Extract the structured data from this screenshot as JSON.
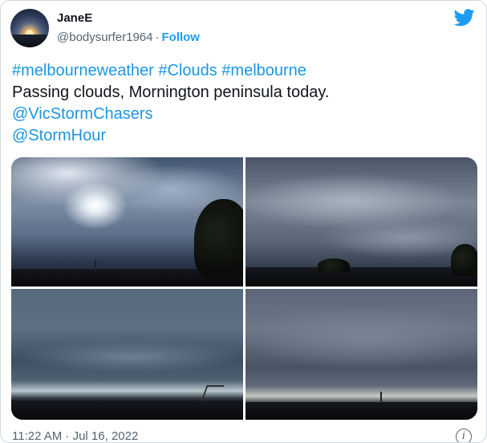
{
  "author": {
    "display_name": "JaneE",
    "handle": "@bodysurfer1964",
    "separator": "·",
    "follow_label": "Follow",
    "avatar_icon": "sunset-avatar"
  },
  "brand": {
    "icon": "twitter-bird-icon",
    "color": "#1d9bf0"
  },
  "tweet": {
    "hashtags": [
      "#melbourneweather",
      "#Clouds",
      "#melbourne"
    ],
    "text": "Passing clouds, Mornington peninsula today.",
    "mentions": [
      "@VicStormChasers",
      "@StormHour"
    ]
  },
  "media": {
    "photo_count": 4
  },
  "footer": {
    "timestamp": "11:22 AM · Jul 16, 2022",
    "info_glyph": "i"
  },
  "colors": {
    "link": "#1b95e0",
    "secondary_text": "#536471",
    "primary_text": "#0f1419",
    "border": "#cfd9de"
  }
}
